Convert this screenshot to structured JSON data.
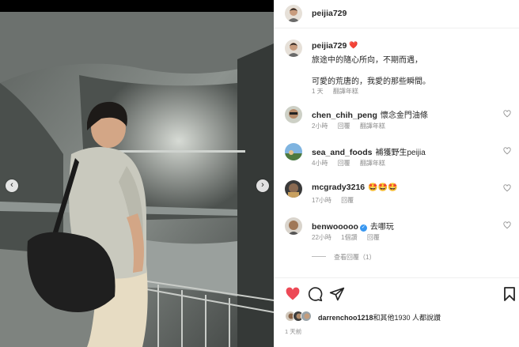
{
  "post": {
    "username": "peijia729",
    "heart_emoji": "❤️",
    "caption_line1": "旅途中的隨心所向，不期而遇，",
    "caption_line2": "可愛的荒唐的，我愛的那些瞬間。",
    "caption_time": "1 天",
    "translate": "翻譯年糕"
  },
  "comments": [
    {
      "user": "chen_chih_peng",
      "text": "懷念金門油條",
      "time": "2小時",
      "reply": "回覆",
      "translate": "翻譯年糕",
      "verified": false
    },
    {
      "user": "sea_and_foods",
      "text": "補獲野生peijia",
      "time": "4小時",
      "reply": "回覆",
      "translate": "翻譯年糕",
      "verified": false
    },
    {
      "user": "mcgrady3216",
      "text": "🤩🤩🤩",
      "time": "17小時",
      "reply": "回覆",
      "translate": "",
      "verified": false
    },
    {
      "user": "benwooooo",
      "text": "去哪玩",
      "time": "22小時",
      "reply": "1個讚",
      "translate": "回覆",
      "verified": true
    }
  ],
  "view_replies": "查看回覆（1）",
  "likes": {
    "user": "darrenchoo1218",
    "text": "和其他1930 人都說讚"
  },
  "post_time": "1 天前",
  "icons": {
    "like": "heart-icon",
    "comment": "comment-icon",
    "share": "share-icon",
    "save": "bookmark-icon",
    "prev": "chevron-left-icon",
    "next": "chevron-right-icon"
  },
  "colors": {
    "like_red": "#ed4956",
    "link_blue": "#3897f0",
    "muted": "#8e8e8e"
  }
}
